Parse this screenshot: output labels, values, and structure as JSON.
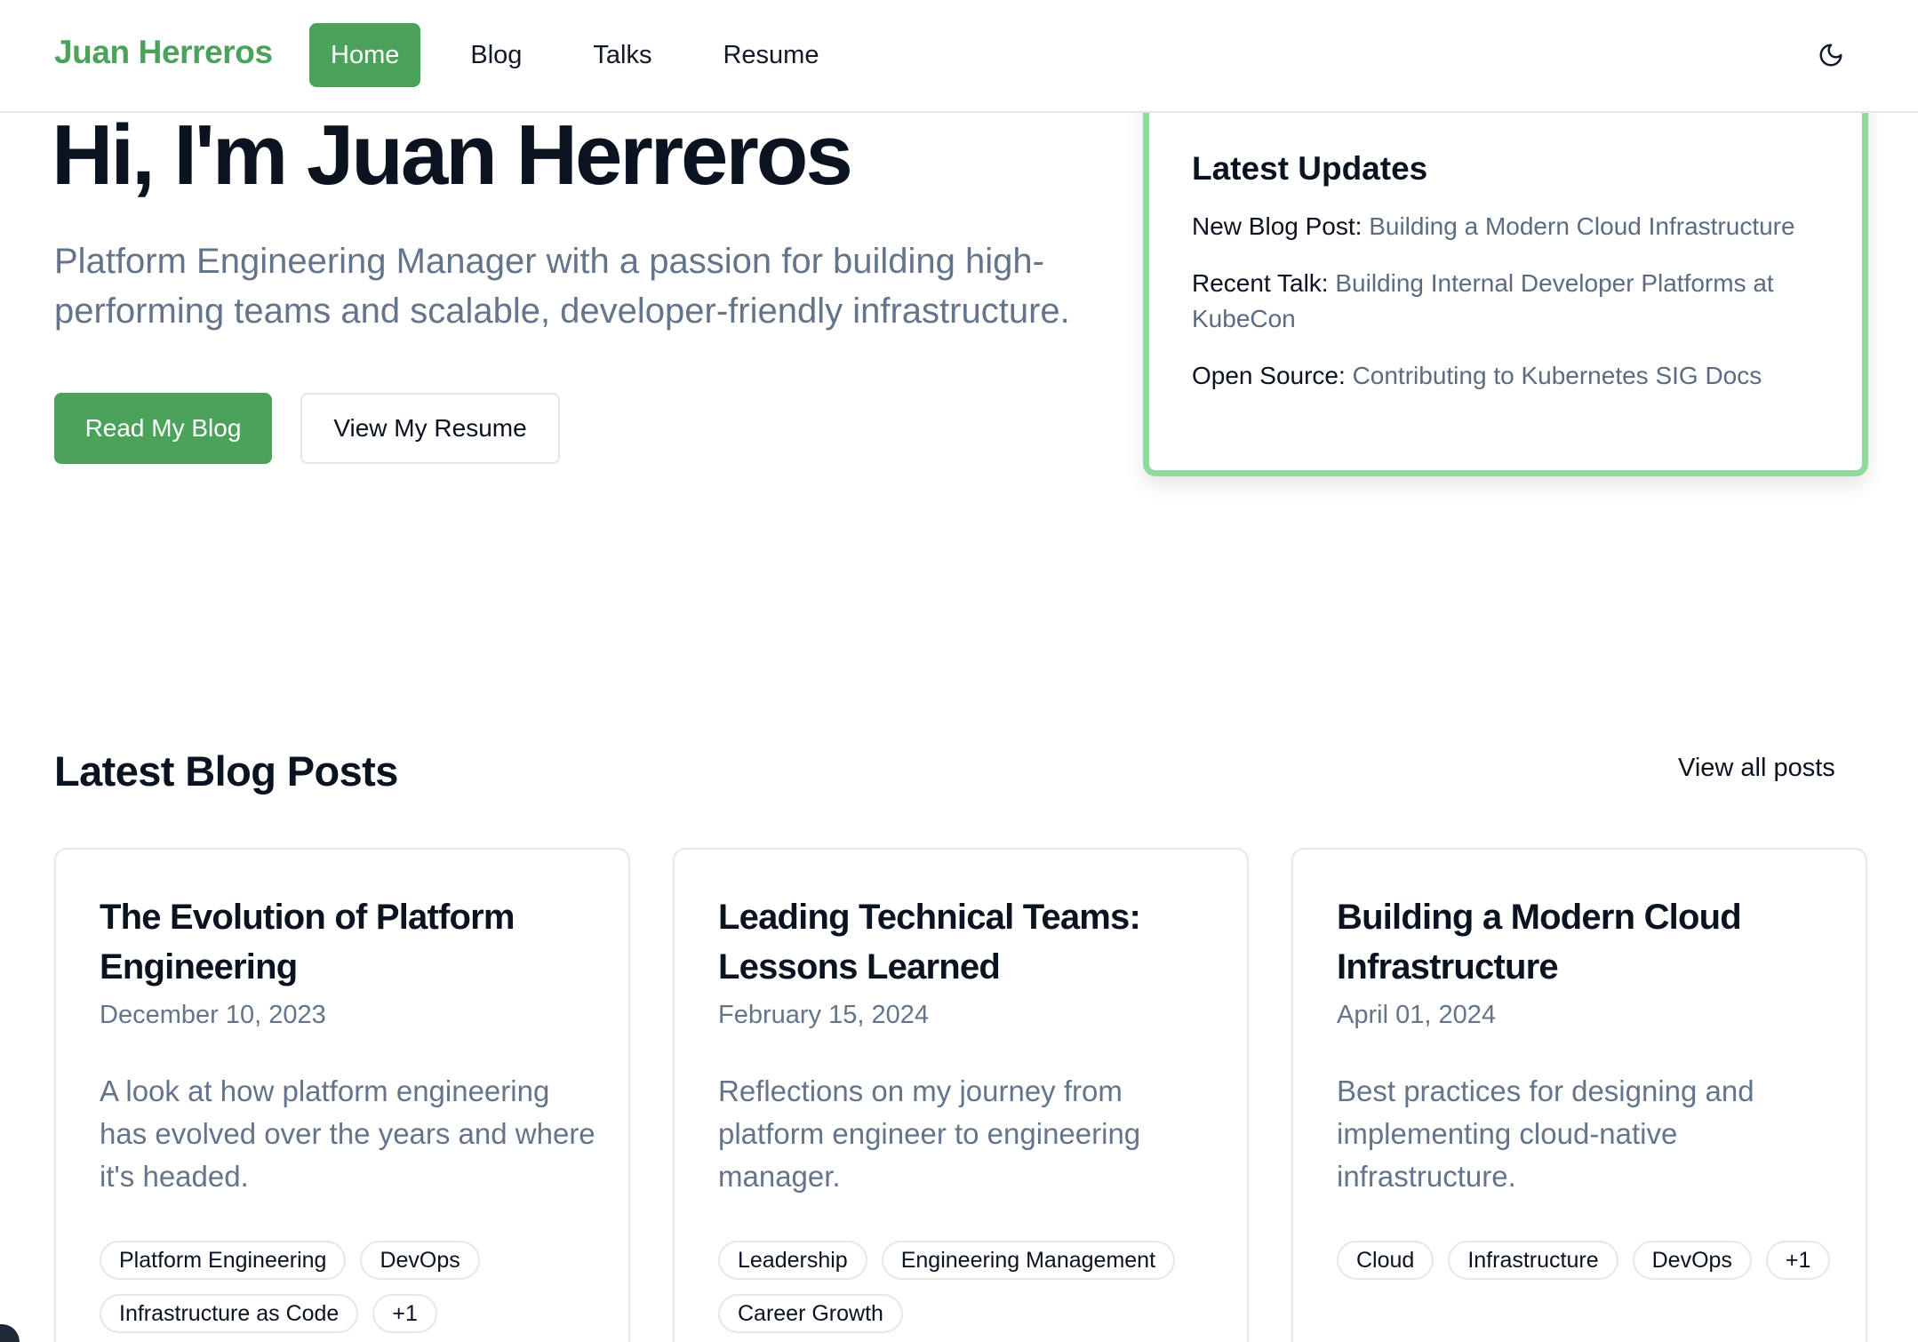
{
  "site": {
    "brand": "Juan Herreros",
    "accent_color": "#4ba25a",
    "nav": [
      {
        "label": "Home",
        "active": true
      },
      {
        "label": "Blog",
        "active": false
      },
      {
        "label": "Talks",
        "active": false
      },
      {
        "label": "Resume",
        "active": false
      }
    ],
    "theme_toggle_icon": "moon-icon"
  },
  "hero": {
    "title": "Hi, I'm Juan Herreros",
    "subtitle": "Platform Engineering Manager with a passion for building high-performing teams and scalable, developer-friendly infrastructure.",
    "primary_button": "Read My Blog",
    "secondary_button": "View My Resume"
  },
  "updates": {
    "title": "Latest Updates",
    "items": [
      {
        "label": "New Blog Post:",
        "link": "Building a Modern Cloud Infrastructure"
      },
      {
        "label": "Recent Talk:",
        "link": "Building Internal Developer Platforms at KubeCon"
      },
      {
        "label": "Open Source:",
        "link": "Contributing to Kubernetes SIG Docs"
      }
    ]
  },
  "blog": {
    "section_title": "Latest Blog Posts",
    "view_all": "View all posts",
    "posts": [
      {
        "title": "The Evolution of Platform Engineering",
        "date": "December 10, 2023",
        "description": "A look at how platform engineering has evolved over the years and where it's headed.",
        "tags": [
          "Platform Engineering",
          "DevOps",
          "Infrastructure as Code",
          "+1"
        ]
      },
      {
        "title": "Leading Technical Teams: Lessons Learned",
        "date": "February 15, 2024",
        "description": "Reflections on my journey from platform engineer to engineering manager.",
        "tags": [
          "Leadership",
          "Engineering Management",
          "Career Growth"
        ]
      },
      {
        "title": "Building a Modern Cloud Infrastructure",
        "date": "April 01, 2024",
        "description": "Best practices for designing and implementing cloud-native infrastructure.",
        "tags": [
          "Cloud",
          "Infrastructure",
          "DevOps",
          "+1"
        ]
      }
    ]
  }
}
